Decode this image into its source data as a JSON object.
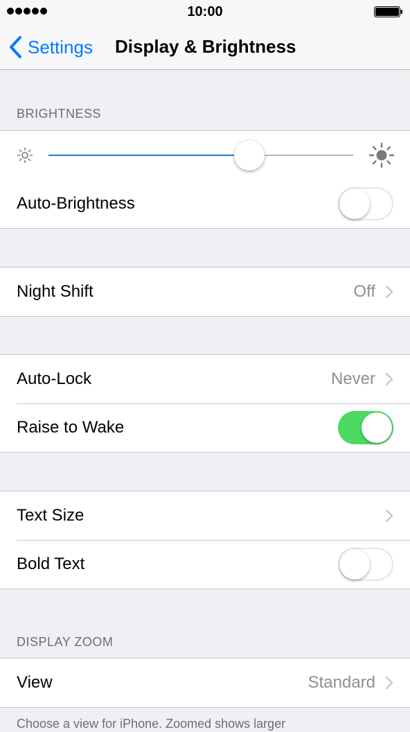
{
  "status_bar": {
    "time": "10:00",
    "signal_icon": "signal-dots-icon",
    "battery_icon": "battery-full-icon"
  },
  "nav": {
    "back_label": "Settings",
    "back_icon": "chevron-left-icon",
    "title": "Display & Brightness"
  },
  "brightness": {
    "header": "BRIGHTNESS",
    "level": 0.66,
    "min_icon": "sun-small-icon",
    "max_icon": "sun-large-icon",
    "auto_label": "Auto-Brightness",
    "auto_on": false
  },
  "night_shift": {
    "label": "Night Shift",
    "value": "Off"
  },
  "lock": {
    "auto_lock_label": "Auto-Lock",
    "auto_lock_value": "Never",
    "raise_label": "Raise to Wake",
    "raise_on": true
  },
  "text": {
    "size_label": "Text Size",
    "bold_label": "Bold Text",
    "bold_on": false
  },
  "zoom": {
    "header": "DISPLAY ZOOM",
    "view_label": "View",
    "view_value": "Standard",
    "footer": "Choose a view for iPhone. Zoomed shows larger"
  },
  "colors": {
    "accent": "#007aff",
    "toggle_on": "#4cd964",
    "slider_fill": "#1d7ad6"
  }
}
